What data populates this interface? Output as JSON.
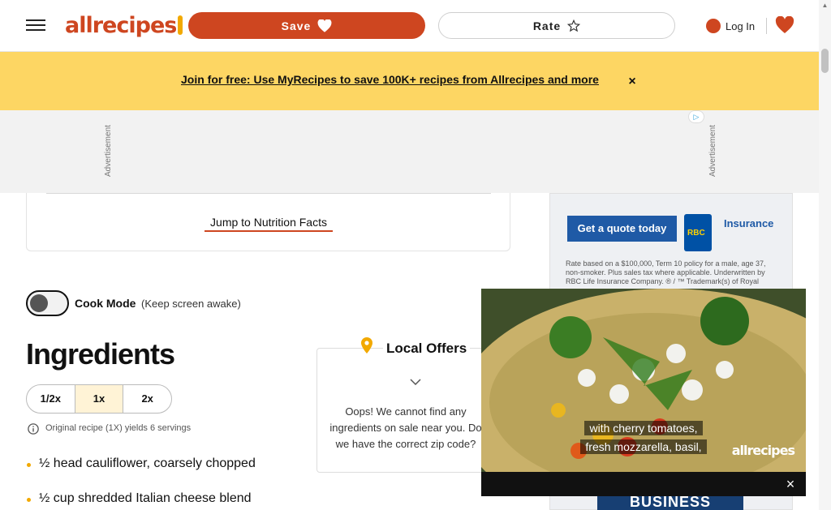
{
  "header": {
    "logo_text": "allrecipes",
    "save_label": "Save",
    "rate_label": "Rate",
    "login_label": "Log In"
  },
  "promo": {
    "link_text": "Join for free: Use MyRecipes to save 100K+ recipes from Allrecipes and more",
    "close_glyph": "×"
  },
  "ad_band": {
    "label": "Advertisement"
  },
  "recipe": {
    "jump_link": "Jump to Nutrition Facts",
    "cook_mode_label": "Cook Mode",
    "cook_mode_sub": "(Keep screen awake)",
    "ingredients_title": "Ingredients",
    "scale_options": [
      "1/2x",
      "1x",
      "2x"
    ],
    "yield_text": "Original recipe (1X) yields 6 servings",
    "ingredients": [
      "½ head cauliflower, coarsely chopped",
      "½ cup shredded Italian cheese blend"
    ]
  },
  "local_offers": {
    "title": "Local Offers",
    "message": "Oops! We cannot find any ingredients on sale near you. Do we have the correct zip code?"
  },
  "side_ad": {
    "cta": "Get a quote today",
    "brand": "RBC",
    "product": "Insurance",
    "fine_print": "Rate based on a $100,000, Term 10 policy for a male, age 37, non-smoker. Plus sales tax where applicable. Underwritten by RBC Life Insurance Company. ® / ™ Trademark(s) of Royal",
    "banner_text": "BUSINESS"
  },
  "video": {
    "caption_line1": "with cherry tomatoes,",
    "caption_line2": "fresh mozzarella, basil,",
    "logo_text": "allrecipes",
    "close_glyph": "×"
  },
  "colors": {
    "brand": "#ce4620",
    "promo_bg": "#fdd663",
    "accent": "#f2a900"
  }
}
